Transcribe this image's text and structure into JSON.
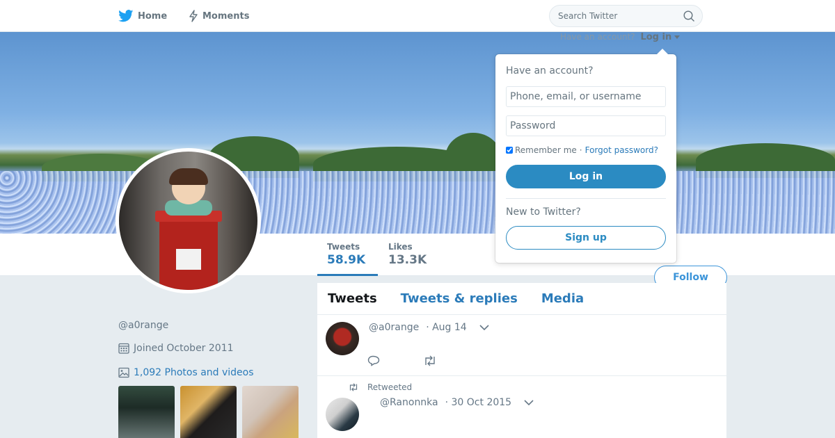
{
  "nav": {
    "home_label": "Home",
    "moments_label": "Moments",
    "search_placeholder": "Search Twitter"
  },
  "login_prompt": {
    "question": "Have an account?",
    "link": "Log in"
  },
  "login_dropdown": {
    "title": "Have an account?",
    "username_placeholder": "Phone, email, or username",
    "password_placeholder": "Password",
    "remember_label": "Remember me",
    "separator": "·",
    "forgot_label": "Forgot password?",
    "login_button": "Log in",
    "new_label": "New to Twitter?",
    "signup_button": "Sign up"
  },
  "profile": {
    "handle": "@a0range",
    "joined": "Joined October 2011",
    "photos_link": "1,092 Photos and videos",
    "follow_button": "Follow"
  },
  "stats": [
    {
      "label": "Tweets",
      "value": "58.9K"
    },
    {
      "label": "Likes",
      "value": "13.3K"
    }
  ],
  "timeline": {
    "tabs": [
      "Tweets",
      "Tweets & replies",
      "Media"
    ],
    "active_tab": "Tweets",
    "tweets": [
      {
        "author": "@a0range",
        "time": "· Aug 14"
      },
      {
        "retweeted_label": "Retweeted",
        "author": "@Ranonnka",
        "time": "· 30 Oct 2015"
      }
    ]
  },
  "colors": {
    "accent": "#2b7bb9",
    "button": "#2b8bc2",
    "background": "#e6ecf0"
  }
}
